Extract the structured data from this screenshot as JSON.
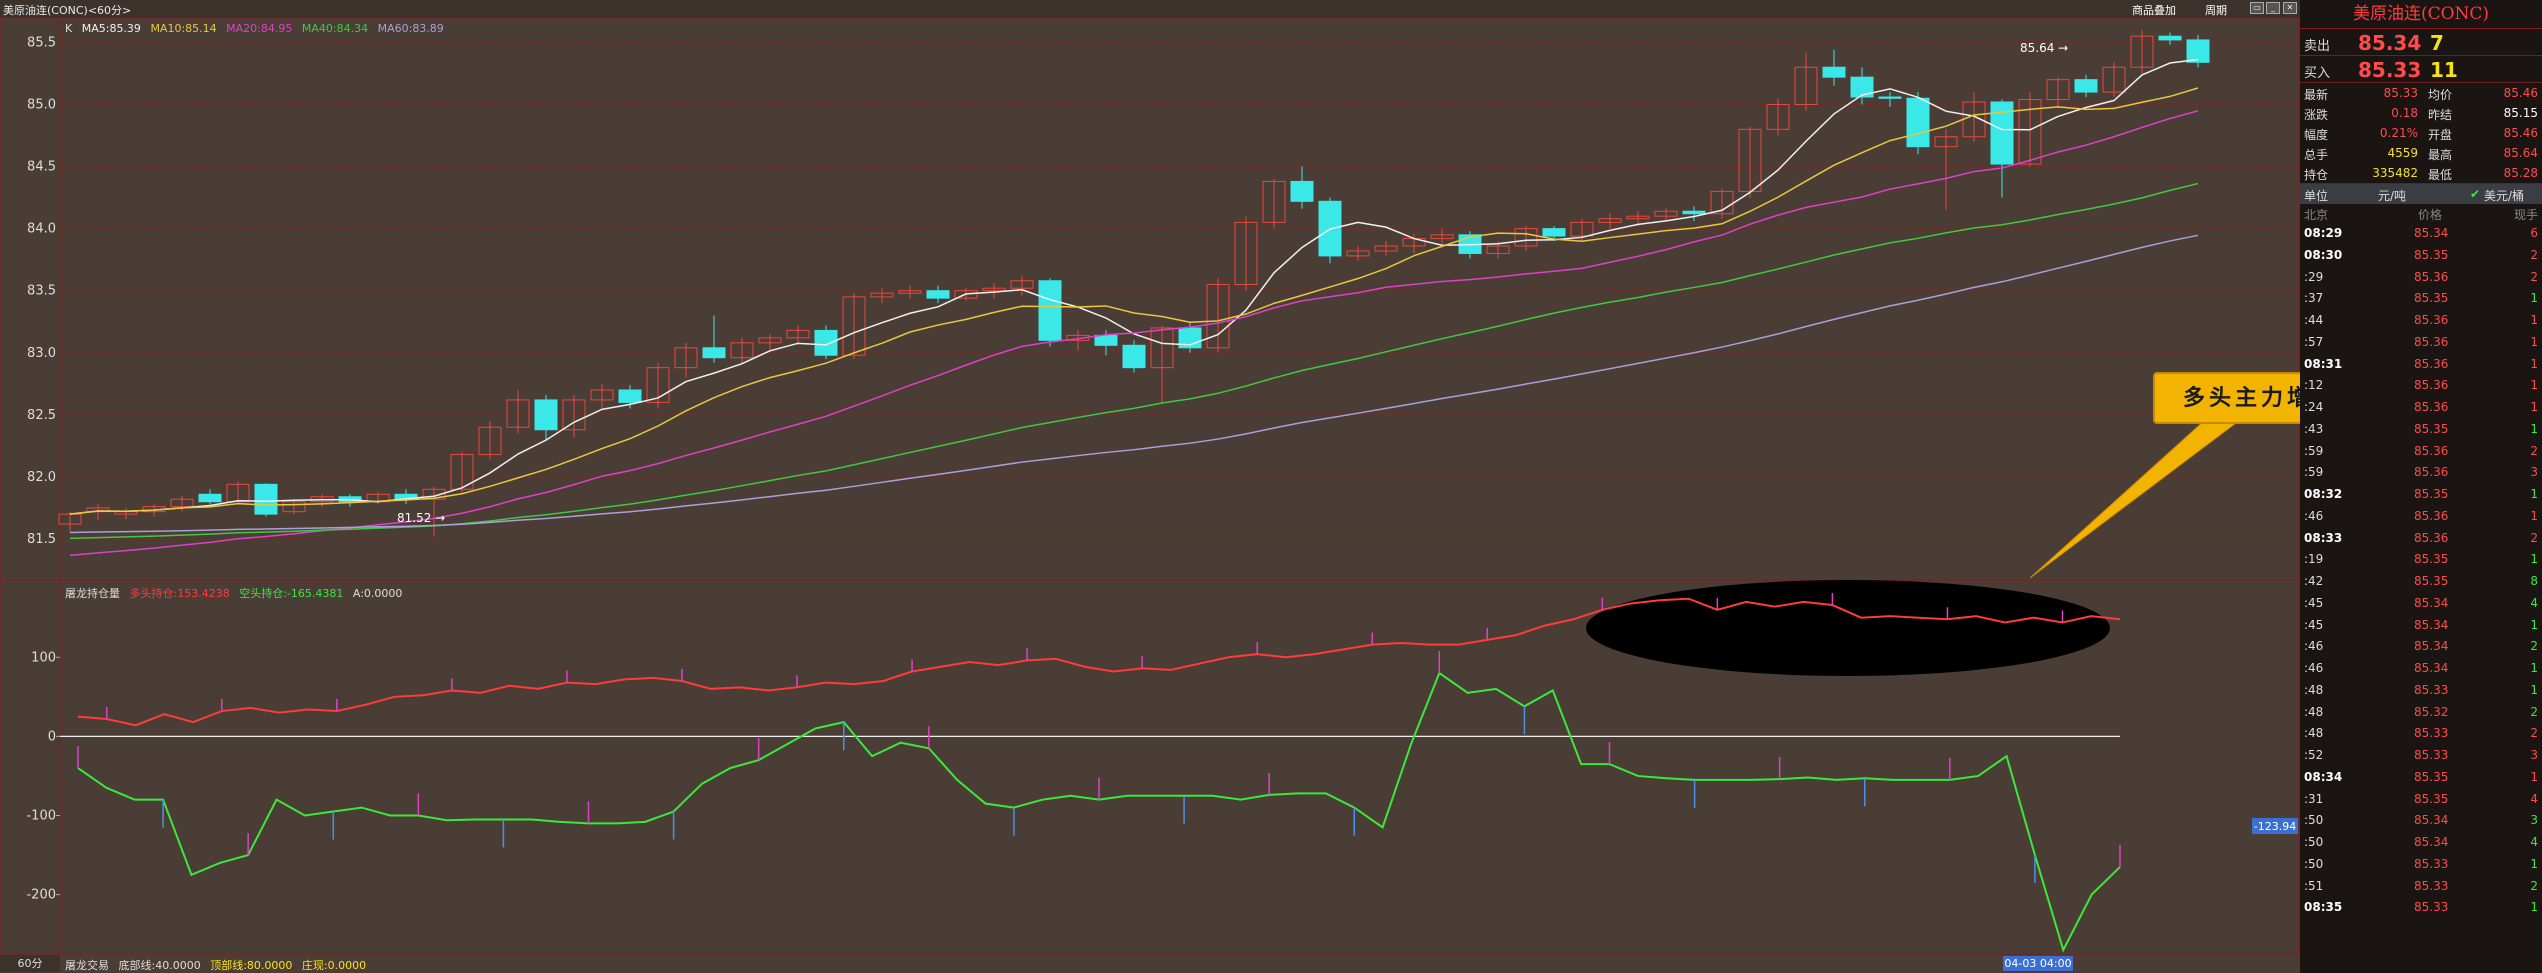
{
  "window": {
    "title": "美原油连(CONC)<60分>",
    "btn_overlay": "商品叠加",
    "btn_period": "周期"
  },
  "colors": {
    "up": "#e8483c",
    "down": "#3ae8e8",
    "ma5": "#f0f0f0",
    "ma10": "#e8c83c",
    "ma20": "#e040c8",
    "ma40": "#40c840",
    "ma60": "#a8a0d8",
    "long": "#ff3b3b",
    "short": "#3be83b"
  },
  "kline": {
    "ylim": [
      81.25,
      85.6
    ],
    "yticks": [
      "85.5",
      "85.0",
      "84.5",
      "84.0",
      "83.5",
      "83.0",
      "82.5",
      "82.0",
      "81.5"
    ],
    "legend": {
      "k": "K",
      "ma5": "MA5:85.39",
      "ma10": "MA10:85.14",
      "ma20": "MA20:84.95",
      "ma40": "MA40:84.34",
      "ma60": "MA60:83.89"
    },
    "candles": [
      [
        81.62,
        81.7,
        81.55,
        81.72
      ],
      [
        81.72,
        81.75,
        81.65,
        81.78
      ],
      [
        81.7,
        81.72,
        81.66,
        81.75
      ],
      [
        81.72,
        81.76,
        81.68,
        81.78
      ],
      [
        81.76,
        81.82,
        81.72,
        81.85
      ],
      [
        81.86,
        81.8,
        81.78,
        81.9
      ],
      [
        81.8,
        81.94,
        81.78,
        81.96
      ],
      [
        81.94,
        81.7,
        81.68,
        81.95
      ],
      [
        81.72,
        81.8,
        81.7,
        81.82
      ],
      [
        81.8,
        81.84,
        81.76,
        81.86
      ],
      [
        81.84,
        81.8,
        81.76,
        81.86
      ],
      [
        81.8,
        81.86,
        81.78,
        81.88
      ],
      [
        81.86,
        81.82,
        81.78,
        81.9
      ],
      [
        81.82,
        81.9,
        81.52,
        81.92
      ],
      [
        81.9,
        82.18,
        81.86,
        82.2
      ],
      [
        82.18,
        82.4,
        82.14,
        82.45
      ],
      [
        82.4,
        82.62,
        82.35,
        82.7
      ],
      [
        82.62,
        82.38,
        82.3,
        82.66
      ],
      [
        82.38,
        82.62,
        82.32,
        82.66
      ],
      [
        82.62,
        82.7,
        82.55,
        82.75
      ],
      [
        82.7,
        82.6,
        82.55,
        82.74
      ],
      [
        82.6,
        82.88,
        82.55,
        82.92
      ],
      [
        82.88,
        83.04,
        82.8,
        83.08
      ],
      [
        83.04,
        82.96,
        82.92,
        83.3
      ],
      [
        82.96,
        83.08,
        82.92,
        83.12
      ],
      [
        83.08,
        83.12,
        83.02,
        83.15
      ],
      [
        83.12,
        83.18,
        83.06,
        83.22
      ],
      [
        83.18,
        82.98,
        82.95,
        83.22
      ],
      [
        82.98,
        83.45,
        82.95,
        83.48
      ],
      [
        83.45,
        83.48,
        83.4,
        83.52
      ],
      [
        83.48,
        83.5,
        83.44,
        83.54
      ],
      [
        83.5,
        83.44,
        83.4,
        83.54
      ],
      [
        83.44,
        83.5,
        83.42,
        83.52
      ],
      [
        83.5,
        83.52,
        83.44,
        83.56
      ],
      [
        83.52,
        83.58,
        83.46,
        83.62
      ],
      [
        83.58,
        83.1,
        83.05,
        83.6
      ],
      [
        83.1,
        83.14,
        83.02,
        83.18
      ],
      [
        83.14,
        83.06,
        82.98,
        83.18
      ],
      [
        83.06,
        82.88,
        82.84,
        83.1
      ],
      [
        82.88,
        83.2,
        82.6,
        83.22
      ],
      [
        83.2,
        83.04,
        83.0,
        83.24
      ],
      [
        83.04,
        83.55,
        83.0,
        83.6
      ],
      [
        83.55,
        84.05,
        83.5,
        84.1
      ],
      [
        84.05,
        84.38,
        84.0,
        84.4
      ],
      [
        84.38,
        84.22,
        84.16,
        84.5
      ],
      [
        84.22,
        83.78,
        83.72,
        84.25
      ],
      [
        83.78,
        83.82,
        83.74,
        83.86
      ],
      [
        83.82,
        83.86,
        83.78,
        83.9
      ],
      [
        83.86,
        83.92,
        83.8,
        83.96
      ],
      [
        83.92,
        83.95,
        83.88,
        84.0
      ],
      [
        83.95,
        83.8,
        83.76,
        83.98
      ],
      [
        83.8,
        83.86,
        83.76,
        83.9
      ],
      [
        83.86,
        84.0,
        83.82,
        84.02
      ],
      [
        84.0,
        83.94,
        83.9,
        84.02
      ],
      [
        83.94,
        84.05,
        83.9,
        84.08
      ],
      [
        84.05,
        84.08,
        84.0,
        84.12
      ],
      [
        84.08,
        84.1,
        84.02,
        84.14
      ],
      [
        84.1,
        84.14,
        84.06,
        84.16
      ],
      [
        84.14,
        84.12,
        84.06,
        84.18
      ],
      [
        84.12,
        84.3,
        84.08,
        84.32
      ],
      [
        84.3,
        84.8,
        84.25,
        84.82
      ],
      [
        84.8,
        85.0,
        84.75,
        85.05
      ],
      [
        85.0,
        85.3,
        84.95,
        85.42
      ],
      [
        85.3,
        85.22,
        85.15,
        85.44
      ],
      [
        85.22,
        85.06,
        85.0,
        85.3
      ],
      [
        85.06,
        85.05,
        84.98,
        85.1
      ],
      [
        85.05,
        84.66,
        84.6,
        85.1
      ],
      [
        84.66,
        84.74,
        84.15,
        84.8
      ],
      [
        84.74,
        85.02,
        84.7,
        85.1
      ],
      [
        85.02,
        84.52,
        84.25,
        85.04
      ],
      [
        84.52,
        85.04,
        84.5,
        85.1
      ],
      [
        85.04,
        85.2,
        84.98,
        85.22
      ],
      [
        85.2,
        85.1,
        85.06,
        85.24
      ],
      [
        85.1,
        85.3,
        85.06,
        85.34
      ],
      [
        85.3,
        85.55,
        85.25,
        85.6
      ],
      [
        85.55,
        85.52,
        85.48,
        85.58
      ],
      [
        85.52,
        85.34,
        85.3,
        85.56
      ]
    ],
    "label_hi": "85.64",
    "label_lo": "81.52"
  },
  "indicator": {
    "name": "屠龙持仓量",
    "long_label": "多头持仓:153.4238",
    "short_label": "空头持仓:-165.4381",
    "a_label": "A:0.0000",
    "ylim": [
      -270,
      185
    ],
    "yticks": [
      "100",
      "0",
      "-100",
      "-200"
    ],
    "long": [
      25,
      22,
      14,
      28,
      18,
      32,
      36,
      30,
      34,
      32,
      40,
      50,
      52,
      58,
      55,
      64,
      60,
      68,
      66,
      72,
      74,
      70,
      60,
      62,
      58,
      62,
      68,
      66,
      70,
      82,
      88,
      94,
      90,
      96,
      98,
      88,
      82,
      86,
      84,
      92,
      100,
      104,
      100,
      104,
      110,
      116,
      118,
      116,
      116,
      122,
      128,
      140,
      148,
      160,
      168,
      172,
      174,
      160,
      170,
      164,
      170,
      166,
      150,
      152,
      150,
      148,
      152,
      144,
      150,
      144,
      152,
      148
    ],
    "short": [
      -40,
      -65,
      -80,
      -80,
      -175,
      -160,
      -150,
      -80,
      -100,
      -95,
      -90,
      -100,
      -100,
      -106,
      -105,
      -105,
      -105,
      -108,
      -110,
      -110,
      -108,
      -95,
      -60,
      -40,
      -30,
      -10,
      10,
      18,
      -25,
      -8,
      -15,
      -55,
      -85,
      -90,
      -80,
      -75,
      -80,
      -75,
      -75,
      -75,
      -75,
      -80,
      -74,
      -72,
      -72,
      -90,
      -115,
      -10,
      80,
      55,
      60,
      38,
      58,
      -35,
      -35,
      -50,
      -53,
      -55,
      -55,
      -55,
      -54,
      -52,
      -55,
      -53,
      -55,
      -55,
      -55,
      -50,
      -25,
      -150,
      -270,
      -200,
      -165
    ],
    "price_tag": "-123.94"
  },
  "bottom": {
    "period": "60分",
    "name": "屠龙交易",
    "l1": "底部线:40.0000",
    "l2": "顶部线:80.0000",
    "l3": "庄现:0.0000",
    "date_tag": "04-03 04:00"
  },
  "callout": {
    "text": "多头主力增仓缓慢"
  },
  "panel": {
    "title": "美原油连(CONC)",
    "sell_label": "卖出",
    "sell_price": "85.34",
    "sell_vol": "7",
    "buy_label": "买入",
    "buy_price": "85.33",
    "buy_vol": "11",
    "stats": [
      {
        "a": "最新",
        "b": "85.33",
        "c": "均价",
        "d": "85.46",
        "bc": "red",
        "dc": "red"
      },
      {
        "a": "涨跌",
        "b": "0.18",
        "c": "昨结",
        "d": "85.15",
        "bc": "red",
        "dc": "wht"
      },
      {
        "a": "幅度",
        "b": "0.21%",
        "c": "开盘",
        "d": "85.46",
        "bc": "red",
        "dc": "red"
      },
      {
        "a": "总手",
        "b": "4559",
        "c": "最高",
        "d": "85.64",
        "bc": "yel",
        "dc": "red"
      },
      {
        "a": "持仓",
        "b": "335482",
        "c": "最低",
        "d": "85.28",
        "bc": "yel",
        "dc": "red"
      }
    ],
    "unit_label": "单位",
    "unit_val": "元/吨",
    "unit_opt": "美元/桶",
    "th": [
      "北京",
      "价格",
      "现手"
    ],
    "ticks": [
      {
        "t": "08:29",
        "p": "85.34",
        "v": "6",
        "b": true,
        "vc": "red"
      },
      {
        "t": "08:30",
        "p": "85.35",
        "v": "2",
        "b": true,
        "vc": "red"
      },
      {
        "t": ":29",
        "p": "85.36",
        "v": "2",
        "b": false,
        "vc": "red"
      },
      {
        "t": ":37",
        "p": "85.35",
        "v": "1",
        "b": false,
        "vc": "grn"
      },
      {
        "t": ":44",
        "p": "85.36",
        "v": "1",
        "b": false,
        "vc": "red"
      },
      {
        "t": ":57",
        "p": "85.36",
        "v": "1",
        "b": false,
        "vc": "red"
      },
      {
        "t": "08:31",
        "p": "85.36",
        "v": "1",
        "b": true,
        "vc": "red"
      },
      {
        "t": ":12",
        "p": "85.36",
        "v": "1",
        "b": false,
        "vc": "red"
      },
      {
        "t": ":24",
        "p": "85.36",
        "v": "1",
        "b": false,
        "vc": "red"
      },
      {
        "t": ":43",
        "p": "85.35",
        "v": "1",
        "b": false,
        "vc": "grn"
      },
      {
        "t": ":59",
        "p": "85.36",
        "v": "2",
        "b": false,
        "vc": "red"
      },
      {
        "t": ":59",
        "p": "85.36",
        "v": "3",
        "b": false,
        "vc": "red"
      },
      {
        "t": "08:32",
        "p": "85.35",
        "v": "1",
        "b": true,
        "vc": "grn"
      },
      {
        "t": ":46",
        "p": "85.36",
        "v": "1",
        "b": false,
        "vc": "red"
      },
      {
        "t": "08:33",
        "p": "85.36",
        "v": "2",
        "b": true,
        "vc": "red"
      },
      {
        "t": ":19",
        "p": "85.35",
        "v": "1",
        "b": false,
        "vc": "grn"
      },
      {
        "t": ":42",
        "p": "85.35",
        "v": "8",
        "b": false,
        "vc": "grn"
      },
      {
        "t": ":45",
        "p": "85.34",
        "v": "4",
        "b": false,
        "vc": "grn"
      },
      {
        "t": ":45",
        "p": "85.34",
        "v": "1",
        "b": false,
        "vc": "grn"
      },
      {
        "t": ":46",
        "p": "85.34",
        "v": "2",
        "b": false,
        "vc": "grn"
      },
      {
        "t": ":46",
        "p": "85.34",
        "v": "1",
        "b": false,
        "vc": "grn"
      },
      {
        "t": ":48",
        "p": "85.33",
        "v": "1",
        "b": false,
        "vc": "grn"
      },
      {
        "t": ":48",
        "p": "85.32",
        "v": "2",
        "b": false,
        "vc": "grn"
      },
      {
        "t": ":48",
        "p": "85.33",
        "v": "2",
        "b": false,
        "vc": "red"
      },
      {
        "t": ":52",
        "p": "85.33",
        "v": "3",
        "b": false,
        "vc": "red"
      },
      {
        "t": "08:34",
        "p": "85.35",
        "v": "1",
        "b": true,
        "vc": "red"
      },
      {
        "t": ":31",
        "p": "85.35",
        "v": "4",
        "b": false,
        "vc": "red"
      },
      {
        "t": ":50",
        "p": "85.34",
        "v": "3",
        "b": false,
        "vc": "grn"
      },
      {
        "t": ":50",
        "p": "85.34",
        "v": "4",
        "b": false,
        "vc": "grn"
      },
      {
        "t": ":50",
        "p": "85.33",
        "v": "1",
        "b": false,
        "vc": "grn"
      },
      {
        "t": ":51",
        "p": "85.33",
        "v": "2",
        "b": false,
        "vc": "grn"
      },
      {
        "t": "08:35",
        "p": "85.33",
        "v": "1",
        "b": true,
        "vc": "grn"
      }
    ]
  },
  "chart_data": {
    "type": "candlestick",
    "series": [
      {
        "name": "K"
      }
    ],
    "indicator_series": [
      "多头持仓",
      "空头持仓"
    ]
  }
}
